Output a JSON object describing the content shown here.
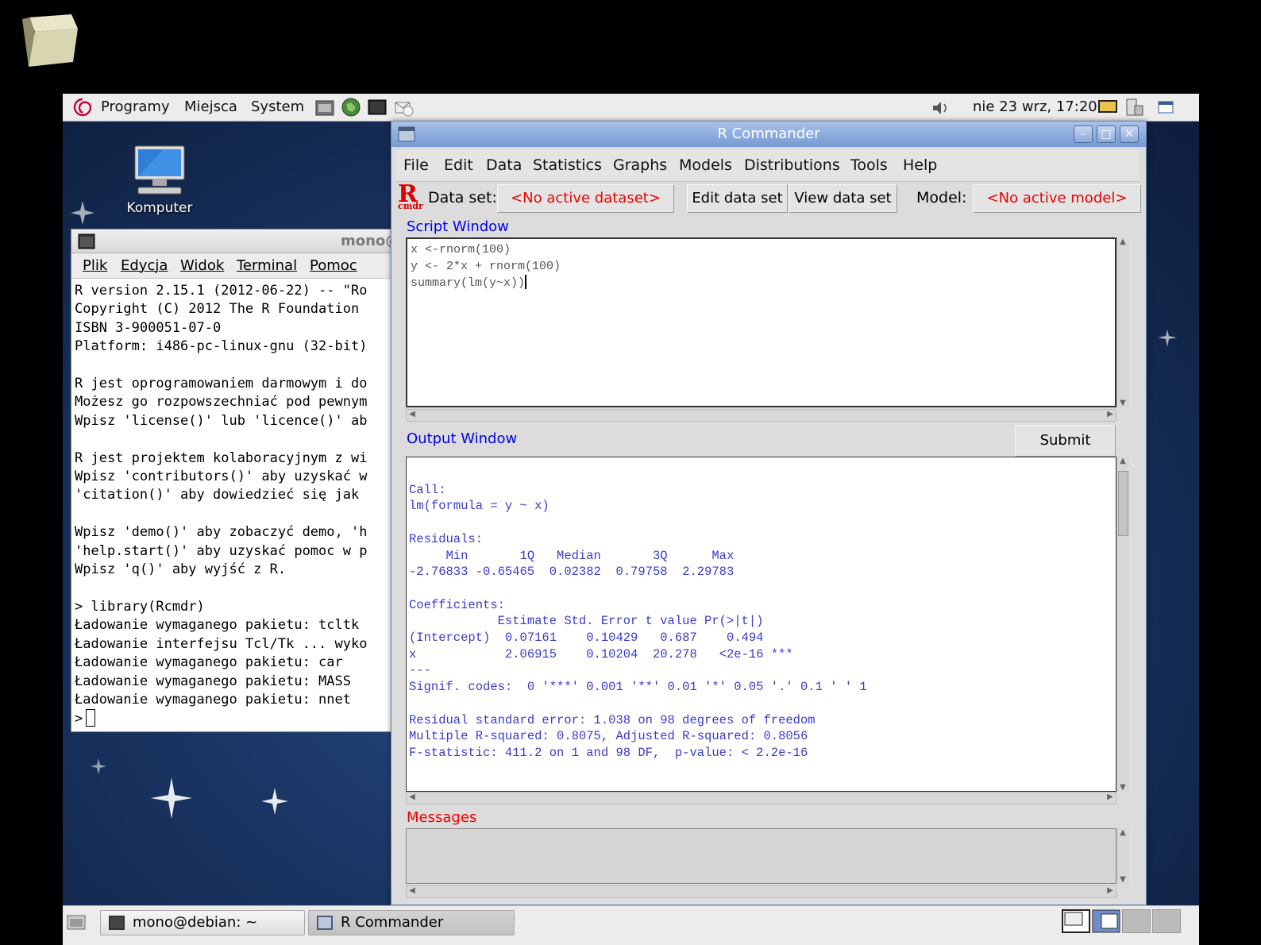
{
  "top_panel": {
    "menus": [
      "Programy",
      "Miejsca",
      "System"
    ],
    "clock": "nie 23 wrz, 17:20",
    "launchers": [
      "update-manager-icon",
      "web-browser-icon",
      "terminal-icon",
      "mail-icon"
    ]
  },
  "desktop": {
    "icon_label": "Komputer"
  },
  "terminal": {
    "title": "mono@",
    "menus": [
      "Plik",
      "Edycja",
      "Widok",
      "Terminal",
      "Pomoc"
    ],
    "lines": [
      "R version 2.15.1 (2012-06-22) -- \"Ro",
      "Copyright (C) 2012 The R Foundation",
      "ISBN 3-900051-07-0",
      "Platform: i486-pc-linux-gnu (32-bit)",
      "",
      "R jest oprogramowaniem darmowym i do",
      "Możesz go rozpowszechniać pod pewnym",
      "Wpisz 'license()' lub 'licence()' ab",
      "",
      "R jest projektem kolaboracyjnym z wi",
      "Wpisz 'contributors()' aby uzyskać w",
      "'citation()' aby dowiedzieć się jak",
      "",
      "Wpisz 'demo()' aby zobaczyć demo, 'h",
      "'help.start()' aby uzyskać pomoc w p",
      "Wpisz 'q()' aby wyjść z R.",
      "",
      "> library(Rcmdr)",
      "Ładowanie wymaganego pakietu: tcltk",
      "Ładowanie interfejsu Tcl/Tk ... wyko",
      "Ładowanie wymaganego pakietu: car",
      "Ładowanie wymaganego pakietu: MASS",
      "Ładowanie wymaganego pakietu: nnet"
    ],
    "prompt": ">"
  },
  "rcmdr": {
    "title": "R Commander",
    "menus": [
      "File",
      "Edit",
      "Data",
      "Statistics",
      "Graphs",
      "Models",
      "Distributions",
      "Tools",
      "Help"
    ],
    "logo_main": "R",
    "logo_sub": "cmdr",
    "dataset_label": "Data set:",
    "dataset_value": "<No active dataset>",
    "edit_dataset": "Edit data set",
    "view_dataset": "View data set",
    "model_label": "Model:",
    "model_value": "<No active model>",
    "script_label": "Script Window",
    "script_lines": [
      "x <-rnorm(100)",
      "y <- 2*x + rnorm(100)",
      "summary(lm(y~x))"
    ],
    "output_label": "Output Window",
    "submit": "Submit",
    "output_lines": [
      "",
      "Call:",
      "lm(formula = y ~ x)",
      "",
      "Residuals:",
      "     Min       1Q   Median       3Q      Max ",
      "-2.76833 -0.65465  0.02382  0.79758  2.29783 ",
      "",
      "Coefficients:",
      "            Estimate Std. Error t value Pr(>|t|)    ",
      "(Intercept)  0.07161    0.10429   0.687    0.494    ",
      "x            2.06915    0.10204  20.278   <2e-16 ***",
      "---",
      "Signif. codes:  0 '***' 0.001 '**' 0.01 '*' 0.05 '.' 0.1 ' ' 1 ",
      "",
      "Residual standard error: 1.038 on 98 degrees of freedom",
      "Multiple R-squared: 0.8075, Adjusted R-squared: 0.8056 ",
      "F-statistic: 411.2 on 1 and 98 DF,  p-value: < 2.2e-16 "
    ],
    "messages_label": "Messages"
  },
  "taskbar": {
    "tasks": [
      "mono@debian: ~",
      "R Commander"
    ]
  },
  "colors": {
    "red_text": "#ee0000",
    "blue_label": "#0000ee",
    "output_text": "#3a3acc",
    "title_bar": "#7699d2"
  }
}
